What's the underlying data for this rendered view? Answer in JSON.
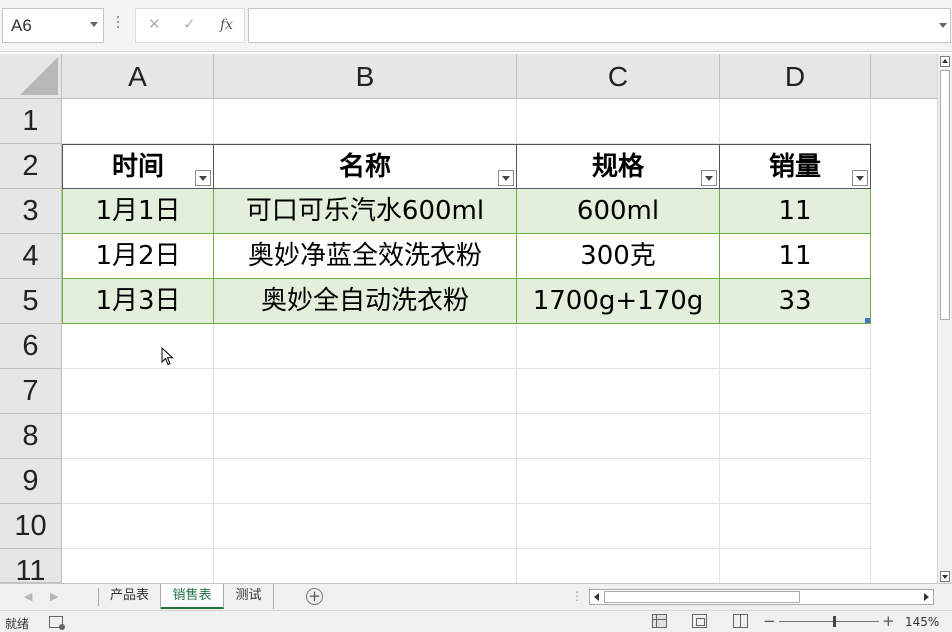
{
  "formula_bar": {
    "name_box": "A6",
    "cancel_icon": "✕",
    "enter_icon": "✓",
    "fx_label": "fx",
    "formula": ""
  },
  "columns": [
    "A",
    "B",
    "C",
    "D"
  ],
  "rows": [
    "1",
    "2",
    "3",
    "4",
    "5",
    "6",
    "7",
    "8",
    "9",
    "10",
    "11"
  ],
  "table": {
    "headers": [
      "时间",
      "名称",
      "规格",
      "销量"
    ],
    "rows": [
      [
        "1月1日",
        "可口可乐汽水600ml",
        "600ml",
        "11"
      ],
      [
        "1月2日",
        "奥妙净蓝全效洗衣粉",
        "300克",
        "11"
      ],
      [
        "1月3日",
        "奥妙全自动洗衣粉",
        "1700g+170g",
        "33"
      ]
    ]
  },
  "sheet_tabs": {
    "tabs": [
      "产品表",
      "销售表",
      "测试"
    ],
    "active": "销售表",
    "add_label": "+"
  },
  "status_bar": {
    "status": "就绪",
    "zoom_minus": "−",
    "zoom_plus": "+",
    "zoom": "145%"
  },
  "colors": {
    "band_fill": "#e2efda",
    "table_border": "#70ad47",
    "accent": "#217346"
  }
}
